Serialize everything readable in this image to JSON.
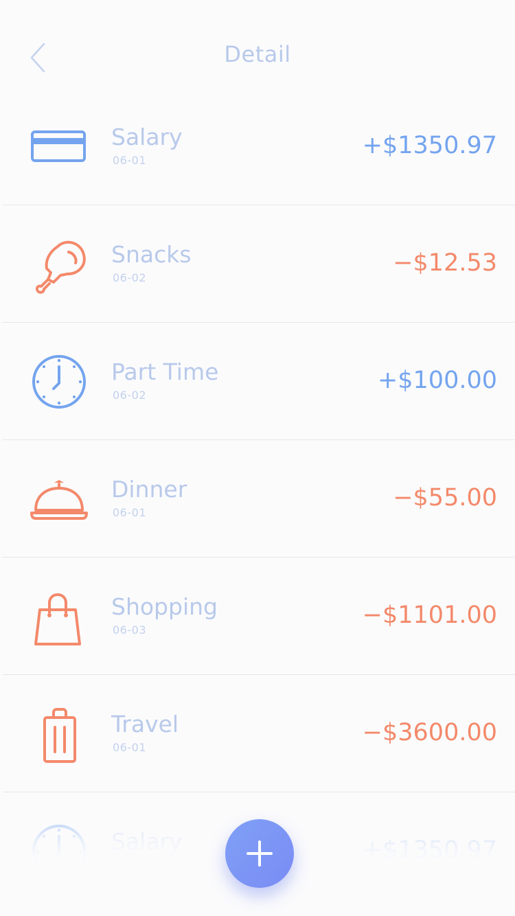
{
  "header": {
    "title": "Detail",
    "back_icon": "chevron-left-icon"
  },
  "colors": {
    "income": "#74a4ee",
    "expense": "#f3896a",
    "label": "#b8c9ea",
    "fab": "#7a8cf4"
  },
  "items": [
    {
      "name": "Salary",
      "date": "06-01",
      "amount": "+$1350.97",
      "type": "income",
      "icon": "credit-card-icon"
    },
    {
      "name": "Snacks",
      "date": "06-02",
      "amount": "−$12.53",
      "type": "expense",
      "icon": "chicken-leg-icon"
    },
    {
      "name": "Part Time",
      "date": "06-02",
      "amount": "+$100.00",
      "type": "income",
      "icon": "clock-icon"
    },
    {
      "name": "Dinner",
      "date": "06-01",
      "amount": "−$55.00",
      "type": "expense",
      "icon": "food-cloche-icon"
    },
    {
      "name": "Shopping",
      "date": "06-03",
      "amount": "−$1101.00",
      "type": "expense",
      "icon": "shopping-bag-icon"
    },
    {
      "name": "Travel",
      "date": "06-01",
      "amount": "−$3600.00",
      "type": "expense",
      "icon": "luggage-icon"
    },
    {
      "name": "Salary",
      "date": "06-01",
      "amount": "+$1350.97",
      "type": "income",
      "icon": "clock-icon"
    }
  ],
  "fab": {
    "icon": "plus-icon"
  }
}
